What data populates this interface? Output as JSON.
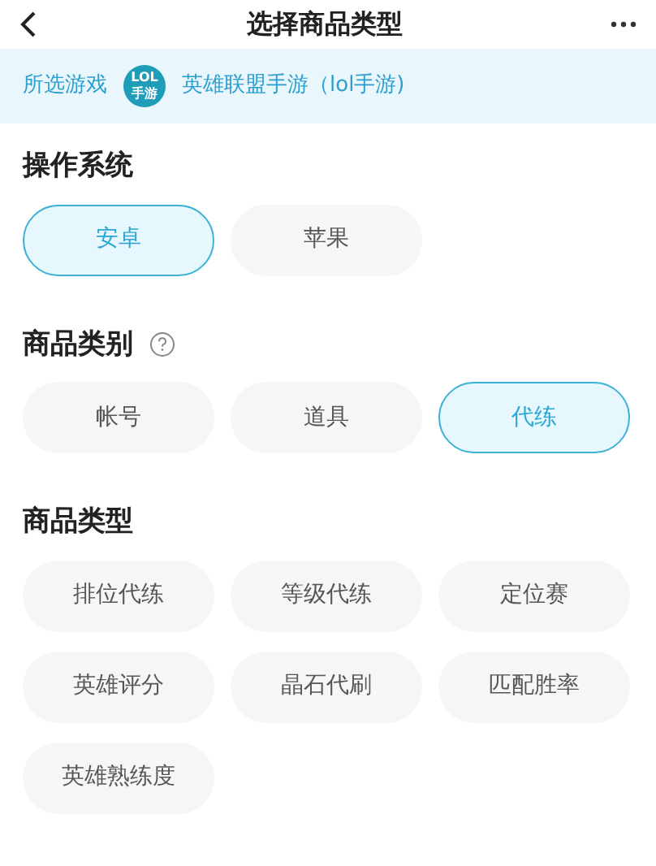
{
  "header": {
    "title": "选择商品类型"
  },
  "game_bar": {
    "label": "所选游戏",
    "icon_lines": [
      "LOL",
      "手游"
    ],
    "game": "英雄联盟手游（lol手游)"
  },
  "sections": [
    {
      "title": "操作系统",
      "help": false,
      "options": [
        {
          "label": "安卓",
          "selected": true
        },
        {
          "label": "苹果",
          "selected": false
        }
      ]
    },
    {
      "title": "商品类别",
      "help": true,
      "options": [
        {
          "label": "帐号",
          "selected": false
        },
        {
          "label": "道具",
          "selected": false
        },
        {
          "label": "代练",
          "selected": true
        }
      ]
    },
    {
      "title": "商品类型",
      "help": false,
      "options": [
        {
          "label": "排位代练",
          "selected": false
        },
        {
          "label": "等级代练",
          "selected": false
        },
        {
          "label": "定位赛",
          "selected": false
        },
        {
          "label": "英雄评分",
          "selected": false
        },
        {
          "label": "晶石代刷",
          "selected": false
        },
        {
          "label": "匹配胜率",
          "selected": false
        },
        {
          "label": "英雄熟练度",
          "selected": false
        }
      ]
    }
  ]
}
